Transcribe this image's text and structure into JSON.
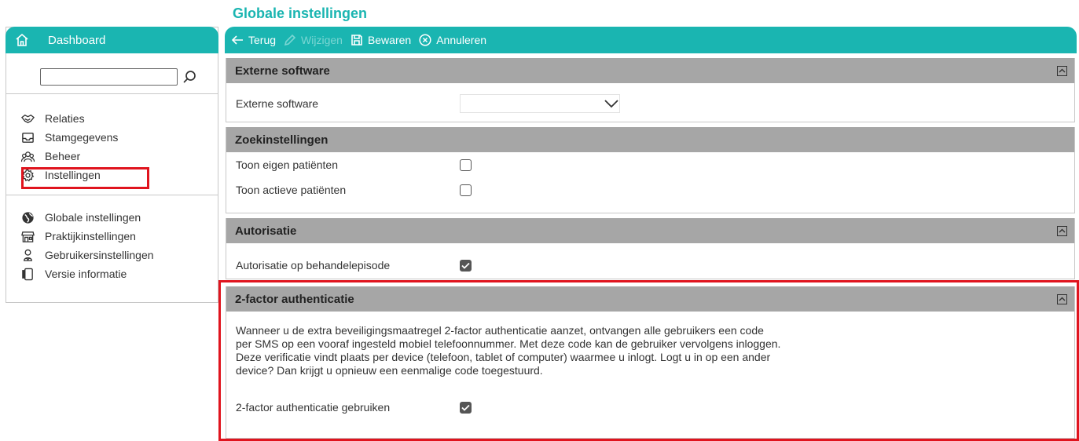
{
  "page_title": "Globale instellingen",
  "colors": {
    "accent": "#1ab5b1",
    "panel_header": "#a6a6a6",
    "highlight": "#e0141e"
  },
  "sidebar": {
    "header_label": "Dashboard",
    "search": {
      "value": "",
      "placeholder": ""
    },
    "group1": [
      {
        "label": "Relaties",
        "icon": "handshake-icon"
      },
      {
        "label": "Stamgegevens",
        "icon": "inbox-icon"
      },
      {
        "label": "Beheer",
        "icon": "users-icon"
      },
      {
        "label": "Instellingen",
        "icon": "gear-icon"
      }
    ],
    "group2": [
      {
        "label": "Globale instellingen",
        "icon": "globe-icon"
      },
      {
        "label": "Praktijkinstellingen",
        "icon": "store-icon"
      },
      {
        "label": "Gebruikersinstellingen",
        "icon": "user-badge-icon"
      },
      {
        "label": "Versie informatie",
        "icon": "device-icon"
      }
    ]
  },
  "toolbar": {
    "back_label": "Terug",
    "edit_label": "Wijzigen",
    "save_label": "Bewaren",
    "cancel_label": "Annuleren"
  },
  "panels": {
    "external": {
      "title": "Externe software",
      "field_label": "Externe software",
      "field_value": ""
    },
    "search_settings": {
      "title": "Zoekinstellingen",
      "own_patients_label": "Toon eigen patiënten",
      "own_patients_checked": false,
      "active_patients_label": "Toon actieve patiënten",
      "active_patients_checked": false
    },
    "authorization": {
      "title": "Autorisatie",
      "field_label": "Autorisatie op behandelepisode",
      "checked": true
    },
    "two_factor": {
      "title": "2-factor authenticatie",
      "description": "Wanneer u de extra beveiligingsmaatregel 2-factor authenticatie aanzet, ontvangen alle gebruikers een code per SMS op een vooraf ingesteld mobiel telefoonnummer. Met deze code kan de gebruiker vervolgens inloggen. Deze verificatie vindt plaats per device (telefoon, tablet of computer) waarmee u inlogt. Logt u in op een ander device? Dan krijgt u opnieuw een eenmalige code toegestuurd.",
      "field_label": "2-factor authenticatie gebruiken",
      "checked": true
    }
  }
}
